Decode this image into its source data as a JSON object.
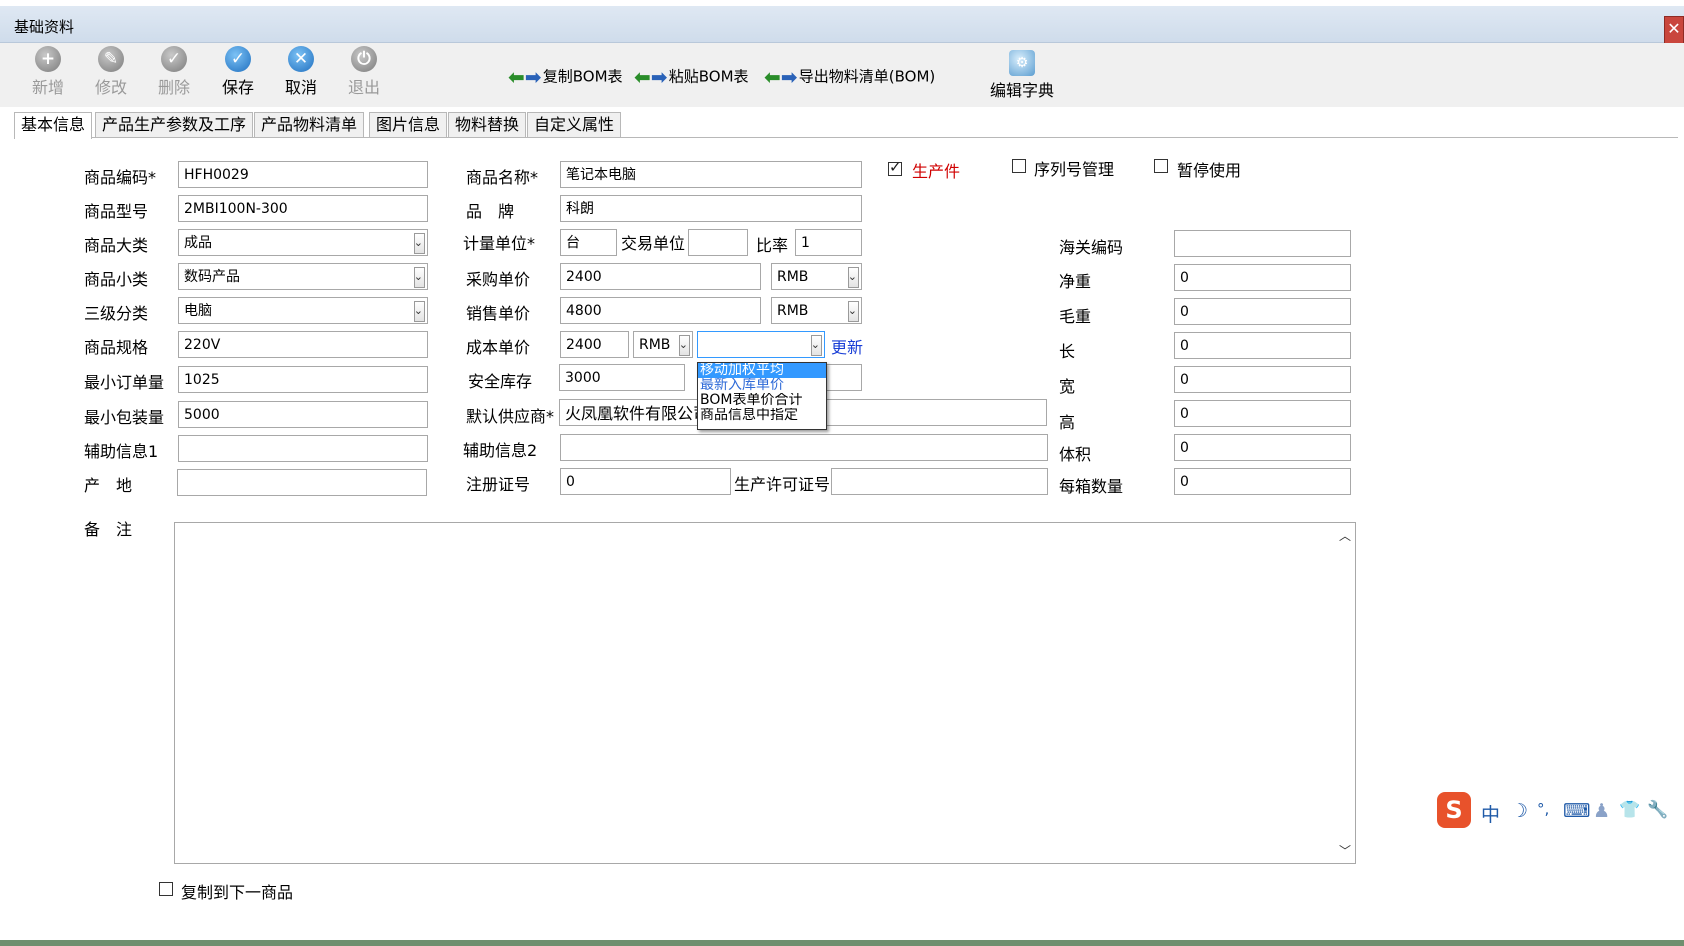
{
  "window": {
    "title": "基础资料",
    "close_glyph": "✕"
  },
  "toolbar": {
    "buttons": [
      {
        "label": "新增",
        "icon": "plus-icon",
        "enabled": false
      },
      {
        "label": "修改",
        "icon": "edit-icon",
        "enabled": false
      },
      {
        "label": "删除",
        "icon": "delete-icon",
        "enabled": false
      },
      {
        "label": "保存",
        "icon": "check-icon",
        "enabled": true
      },
      {
        "label": "取消",
        "icon": "cancel-icon",
        "enabled": true
      },
      {
        "label": "退出",
        "icon": "exit-icon",
        "enabled": false
      }
    ],
    "copy_bom": "复制BOM表",
    "paste_bom": "粘贴BOM表",
    "export_bom": "导出物料清单(BOM)",
    "edit_dict": "编辑字典"
  },
  "tabs": [
    "基本信息",
    "产品生产参数及工序",
    "产品物料清单",
    "图片信息",
    "物料替换",
    "自定义属性"
  ],
  "form": {
    "code_label": "商品编码*",
    "code": "HFH0029",
    "name_label": "商品名称*",
    "name": "笔记本电脑",
    "model_label": "商品型号",
    "model": "2MBI100N-300",
    "brand_label": "品　牌",
    "brand": "科朗",
    "category_label": "商品大类",
    "category": "成品",
    "subcategory_label": "商品小类",
    "subcategory": "数码产品",
    "level3_label": "三级分类",
    "level3": "电脑",
    "spec_label": "商品规格",
    "spec": "220V",
    "min_order_label": "最小订单量",
    "min_order": "1025",
    "min_pack_label": "最小包装量",
    "min_pack": "5000",
    "aux1_label": "辅助信息1",
    "aux1": "",
    "origin_label": "产　地",
    "origin": "",
    "unit_label": "计量单位*",
    "unit": "台",
    "trade_unit_label": "交易单位",
    "trade_unit": "",
    "ratio_label": "比率",
    "ratio": "1",
    "purchase_price_label": "采购单价",
    "purchase_price": "2400",
    "purchase_currency": "RMB",
    "sale_price_label": "销售单价",
    "sale_price": "4800",
    "sale_currency": "RMB",
    "cost_price_label": "成本单价",
    "cost_price": "2400",
    "cost_currency": "RMB",
    "cost_method": "",
    "update_link": "更新",
    "safety_stock_label": "安全库存",
    "safety_stock": "3000",
    "supplier_label": "默认供应商*",
    "supplier": "火凤凰软件有限公司",
    "aux2_label": "辅助信息2",
    "aux2": "",
    "reg_no_label": "注册证号",
    "reg_no": "0",
    "license_label": "生产许可证号",
    "license": "",
    "customs_label": "海关编码",
    "customs": "",
    "net_weight_label": "净重",
    "net_weight": "0",
    "gross_weight_label": "毛重",
    "gross_weight": "0",
    "length_label": "长",
    "length": "0",
    "width_label": "宽",
    "width": "0",
    "height_label": "高",
    "height": "0",
    "volume_label": "体积",
    "volume": "0",
    "per_box_label": "每箱数量",
    "per_box": "0",
    "remark_label": "备　注",
    "remark": "",
    "production_part_label": "生产件",
    "production_part_checked": true,
    "serial_label": "序列号管理",
    "serial_checked": false,
    "pause_label": "暂停使用",
    "pause_checked": false,
    "copy_next_label": "复制到下一商品",
    "copy_next_checked": false
  },
  "cost_method_dropdown": {
    "options": [
      "移动加权平均",
      "最新入库单价",
      "BOM表单价合计",
      "商品信息中指定"
    ],
    "highlighted_index": 0
  },
  "ime": {
    "logo": "S",
    "mode": "中",
    "items": [
      "☽",
      "°,",
      "⌨",
      "♟",
      "👕",
      "🔧"
    ]
  },
  "colors": {
    "titlebar": "#cfdceb",
    "accent": "#1a3fd6",
    "highlight": "#3399ff",
    "required": "#d00000"
  }
}
